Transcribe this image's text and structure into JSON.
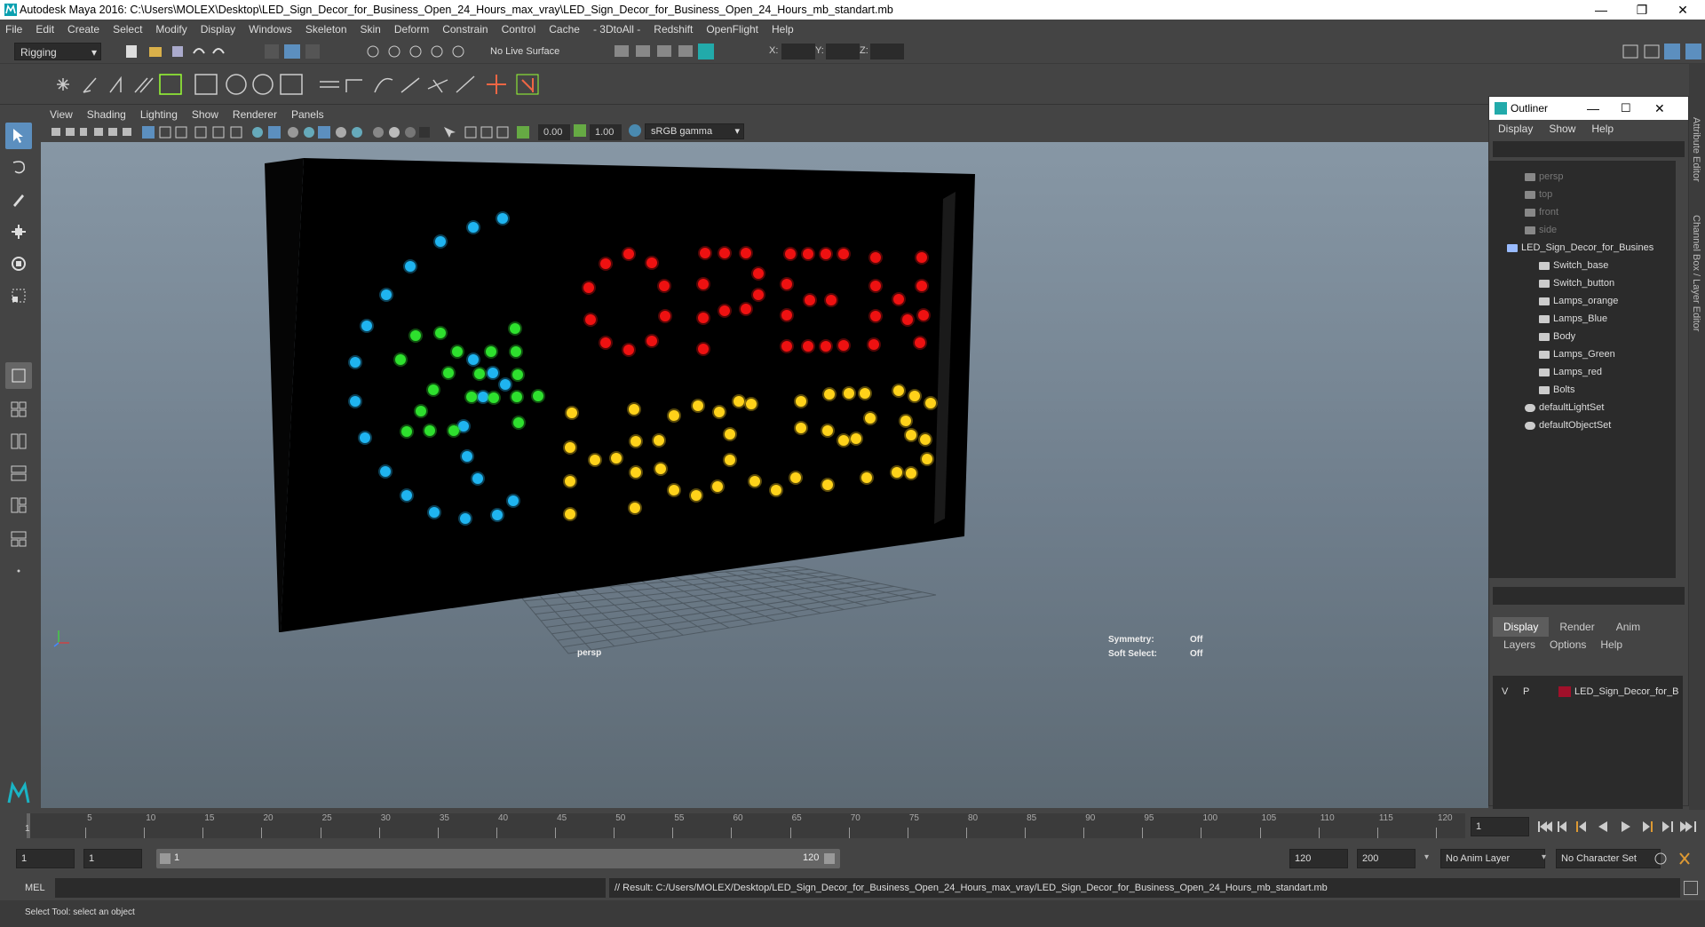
{
  "window": {
    "title": "Autodesk Maya 2016: C:\\Users\\MOLEX\\Desktop\\LED_Sign_Decor_for_Business_Open_24_Hours_max_vray\\LED_Sign_Decor_for_Business_Open_24_Hours_mb_standart.mb",
    "minimize": "—",
    "restore": "❐",
    "close": "✕"
  },
  "menubar": [
    "File",
    "Edit",
    "Create",
    "Select",
    "Modify",
    "Display",
    "Windows",
    "Skeleton",
    "Skin",
    "Deform",
    "Constrain",
    "Control",
    "Cache",
    "- 3DtoAll -",
    "Redshift",
    "OpenFlight",
    "Help"
  ],
  "statusline": {
    "mode": "Rigging",
    "live_surface": "No Live Surface",
    "x_label": "X:",
    "y_label": "Y:",
    "z_label": "Z:"
  },
  "viewport": {
    "menus": [
      "View",
      "Shading",
      "Lighting",
      "Show",
      "Renderer",
      "Panels"
    ],
    "exposure": "0.00",
    "gamma": "1.00",
    "color_space": "sRGB gamma",
    "camera_label": "persp",
    "symmetry_label": "Symmetry:",
    "symmetry_value": "Off",
    "soft_select_label": "Soft Select:",
    "soft_select_value": "Off",
    "axis_y": "y",
    "axis_x": "x"
  },
  "outliner": {
    "title": "Outliner",
    "menus": [
      "Display",
      "Show",
      "Help"
    ],
    "items": [
      {
        "label": "persp",
        "dim": true
      },
      {
        "label": "top",
        "dim": true
      },
      {
        "label": "front",
        "dim": true
      },
      {
        "label": "side",
        "dim": true
      },
      {
        "label": "LED_Sign_Decor_for_Busines",
        "dim": false
      },
      {
        "label": "Switch_base",
        "dim": false
      },
      {
        "label": "Switch_button",
        "dim": false
      },
      {
        "label": "Lamps_orange",
        "dim": false
      },
      {
        "label": "Lamps_Blue",
        "dim": false
      },
      {
        "label": "Body",
        "dim": false
      },
      {
        "label": "Lamps_Green",
        "dim": false
      },
      {
        "label": "Lamps_red",
        "dim": false
      },
      {
        "label": "Bolts",
        "dim": false
      },
      {
        "label": "defaultLightSet",
        "dim": false
      },
      {
        "label": "defaultObjectSet",
        "dim": false
      }
    ]
  },
  "layers": {
    "tabs": [
      "Display",
      "Render",
      "Anim"
    ],
    "menus": [
      "Layers",
      "Options",
      "Help"
    ],
    "layer": {
      "v": "V",
      "p": "P",
      "name": "LED_Sign_Decor_for_B"
    },
    "color": "#a0102a"
  },
  "side_tabs": [
    "Attribute Editor",
    "Channel Box / Layer Editor"
  ],
  "timeline": {
    "ticks": [
      "5",
      "10",
      "15",
      "20",
      "25",
      "30",
      "35",
      "40",
      "45",
      "50",
      "55",
      "60",
      "65",
      "70",
      "75",
      "80",
      "85",
      "90",
      "95",
      "100",
      "105",
      "110",
      "115",
      "120"
    ],
    "current_start": "1",
    "current_frame": "1"
  },
  "range": {
    "start": "1",
    "start2": "1",
    "slider_start": "1",
    "slider_end": "120",
    "end": "120",
    "end2": "200",
    "anim_layer": "No Anim Layer",
    "char_set": "No Character Set"
  },
  "cmd": {
    "label": "MEL",
    "result": "// Result: C:/Users/MOLEX/Desktop/LED_Sign_Decor_for_Business_Open_24_Hours_max_vray/LED_Sign_Decor_for_Business_Open_24_Hours_mb_standart.mb"
  },
  "help": {
    "text": "Select Tool: select an object"
  },
  "colors": {
    "blue_led": "#1fb4f0",
    "green_led": "#2ee02e",
    "red_led": "#ee1111",
    "yellow_led": "#ffd21a"
  }
}
